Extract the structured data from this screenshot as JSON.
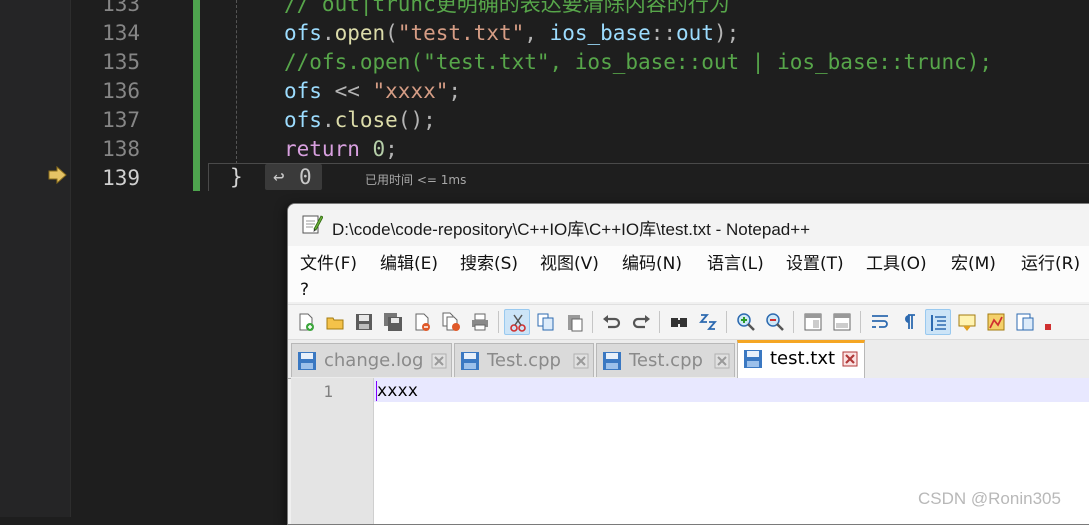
{
  "editor": {
    "lines": [
      {
        "num": "133",
        "segments": [
          {
            "t": "// out|trunc更明确的表达要清除内容的行为",
            "c": "comment"
          }
        ]
      },
      {
        "num": "134",
        "segments": [
          {
            "t": "ofs",
            "c": "id"
          },
          {
            "t": ".",
            "c": "op"
          },
          {
            "t": "open",
            "c": "fn"
          },
          {
            "t": "(",
            "c": "op"
          },
          {
            "t": "\"test.txt\"",
            "c": "str"
          },
          {
            "t": ", ",
            "c": "op"
          },
          {
            "t": "ios_base",
            "c": "id"
          },
          {
            "t": "::",
            "c": "op"
          },
          {
            "t": "out",
            "c": "id"
          },
          {
            "t": ");",
            "c": "op"
          }
        ]
      },
      {
        "num": "135",
        "segments": [
          {
            "t": "//ofs.open(\"test.txt\", ios_base::out | ios_base::trunc);",
            "c": "comment"
          }
        ]
      },
      {
        "num": "136",
        "segments": [
          {
            "t": "ofs",
            "c": "id"
          },
          {
            "t": " << ",
            "c": "op"
          },
          {
            "t": "\"xxxx\"",
            "c": "str"
          },
          {
            "t": ";",
            "c": "op"
          }
        ]
      },
      {
        "num": "137",
        "segments": [
          {
            "t": "ofs",
            "c": "id"
          },
          {
            "t": ".",
            "c": "op"
          },
          {
            "t": "close",
            "c": "fn"
          },
          {
            "t": "();",
            "c": "op"
          }
        ]
      },
      {
        "num": "138",
        "segments": [
          {
            "t": "return",
            "c": "kw"
          },
          {
            "t": " ",
            "c": "op"
          },
          {
            "t": "0",
            "c": "num"
          },
          {
            "t": ";",
            "c": "op"
          }
        ]
      },
      {
        "num": "139",
        "segments": []
      }
    ],
    "current_line": "139",
    "closing_brace": "}",
    "return_icon": "↩",
    "return_value": "0",
    "elapsed_hint": "已用时间 <= 1ms"
  },
  "notepad": {
    "title": "D:\\code\\code-repository\\C++IO库\\C++IO库\\test.txt - Notepad++",
    "menu": [
      "文件(F)",
      "编辑(E)",
      "搜索(S)",
      "视图(V)",
      "编码(N)",
      "语言(L)",
      "设置(T)",
      "工具(O)",
      "宏(M)",
      "运行(R)",
      "?"
    ],
    "toolbar_icons": [
      "new-file-icon",
      "open-file-icon",
      "save-icon",
      "save-all-icon",
      "close-icon",
      "close-all-icon",
      "print-icon",
      "cut-icon",
      "copy-icon",
      "paste-icon",
      "undo-icon",
      "redo-icon",
      "find-icon",
      "replace-icon",
      "zoom-in-icon",
      "zoom-out-icon",
      "sync-vertical-icon",
      "sync-horizontal-icon",
      "word-wrap-icon",
      "show-all-chars-icon",
      "indent-guide-icon",
      "user-language-icon",
      "document-map-icon",
      "function-list-icon"
    ],
    "tabs": [
      {
        "label": "change.log",
        "active": false
      },
      {
        "label": "Test.cpp",
        "active": false
      },
      {
        "label": "Test.cpp",
        "active": false
      },
      {
        "label": "test.txt",
        "active": true
      }
    ],
    "line_numbers": [
      "1"
    ],
    "content_lines": [
      "xxxx"
    ]
  },
  "watermark": "CSDN @Ronin305",
  "colors": {
    "vs_background": "#1e1e1e",
    "change_bar": "#4ea44e",
    "comment": "#57a64a",
    "string": "#d69d85",
    "keyword": "#d8a0df",
    "tab_active_accent": "#f5a623",
    "current_line_highlight": "#e8e8ff"
  }
}
